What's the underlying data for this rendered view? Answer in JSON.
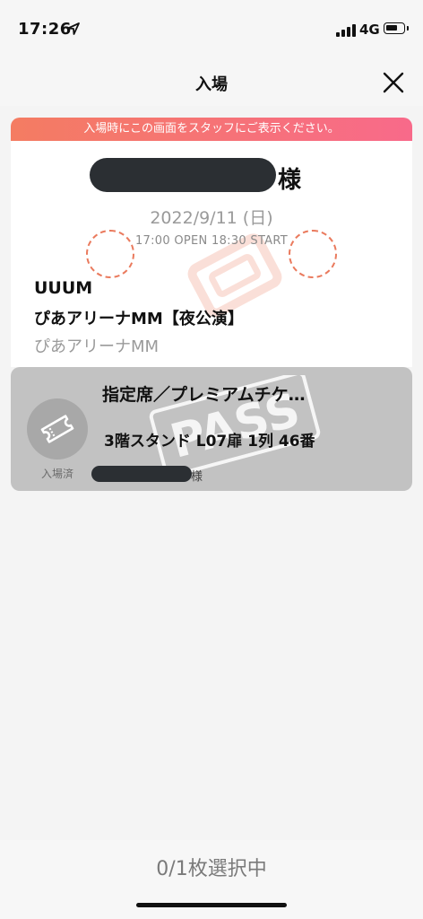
{
  "status_bar": {
    "time": "17:26",
    "network": "4G",
    "icons": [
      "location-arrow-icon",
      "signal-icon",
      "battery-icon"
    ]
  },
  "header": {
    "title": "入場",
    "close_icon": "close-icon"
  },
  "banner": {
    "text": "入場時にこの画面をスタッフにご表示ください。"
  },
  "ticket": {
    "honorific": "様",
    "date": "2022/9/11 (日)",
    "time": "17:00 OPEN 18:30 START",
    "organizer": "UUUM",
    "event": "ぴあアリーナMM【夜公演】",
    "venue": "ぴあアリーナMM"
  },
  "seat": {
    "type": "指定席／プレミアムチケ…",
    "location": "3階スタンド L07扉 1列 46番",
    "status_label": "入場済",
    "honorific": "様",
    "stamp_text": "PASS",
    "ticket_icon": "ticket-icon"
  },
  "footer": {
    "selection": "0/1枚選択中"
  },
  "colors": {
    "banner_start": "#f47c62",
    "banner_end": "#f86a8a",
    "accent_dashed": "#ea7a5d",
    "panel_gray": "#c2c2c2"
  }
}
